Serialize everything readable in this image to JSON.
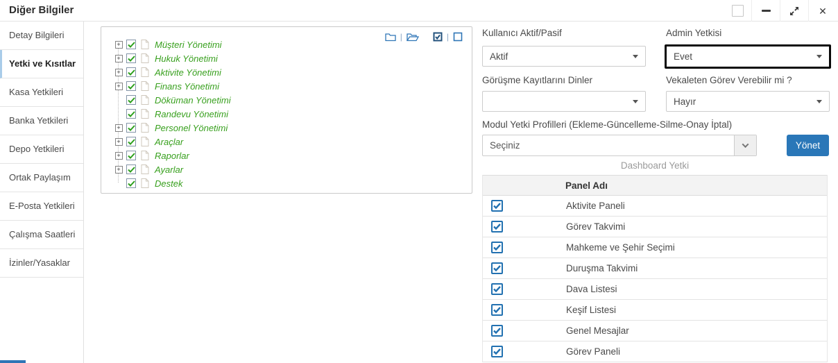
{
  "window": {
    "title": "Diğer Bilgiler",
    "controls": {
      "box": "box-icon",
      "minimize": "minimize-icon",
      "maximize": "maximize-icon",
      "close": "close-icon"
    }
  },
  "sidebar": {
    "items": [
      {
        "label": "Detay Bilgileri",
        "active": false
      },
      {
        "label": "Yetki ve Kısıtlar",
        "active": true
      },
      {
        "label": "Kasa Yetkileri",
        "active": false
      },
      {
        "label": "Banka Yetkileri",
        "active": false
      },
      {
        "label": "Depo Yetkileri",
        "active": false
      },
      {
        "label": "Ortak Paylaşım",
        "active": false
      },
      {
        "label": "E-Posta Yetkileri",
        "active": false
      },
      {
        "label": "Çalışma Saatleri",
        "active": false
      },
      {
        "label": "İzinler/Yasaklar",
        "active": false
      }
    ]
  },
  "tree": {
    "toolbar_icons": [
      "folder-closed-icon",
      "folder-open-icon",
      "check-all-icon",
      "uncheck-all-icon"
    ],
    "separator": "|",
    "items": [
      {
        "label": "Müşteri Yönetimi",
        "expandable": true,
        "checked": true
      },
      {
        "label": "Hukuk Yönetimi",
        "expandable": true,
        "checked": true
      },
      {
        "label": "Aktivite Yönetimi",
        "expandable": true,
        "checked": true
      },
      {
        "label": "Finans Yönetimi",
        "expandable": true,
        "checked": true
      },
      {
        "label": "Döküman Yönetimi",
        "expandable": false,
        "checked": true
      },
      {
        "label": "Randevu Yönetimi",
        "expandable": false,
        "checked": true
      },
      {
        "label": "Personel Yönetimi",
        "expandable": true,
        "checked": true
      },
      {
        "label": "Araçlar",
        "expandable": true,
        "checked": true
      },
      {
        "label": "Raporlar",
        "expandable": true,
        "checked": true
      },
      {
        "label": "Ayarlar",
        "expandable": true,
        "checked": true
      },
      {
        "label": "Destek",
        "expandable": false,
        "checked": true
      }
    ]
  },
  "form": {
    "fields": [
      {
        "label": "Kullanıcı Aktif/Pasif",
        "value": "Aktif",
        "focused": false
      },
      {
        "label": "Admin Yetkisi",
        "value": "Evet",
        "focused": true
      },
      {
        "label": "Görüşme Kayıtlarını Dinler",
        "value": "",
        "focused": false
      },
      {
        "label": "Vekaleten Görev Verebilir mi ?",
        "value": "Hayır",
        "focused": false
      }
    ],
    "profile_label": "Modul Yetki Profilleri (Ekleme-Güncelleme-Silme-Onay İptal)",
    "profile_placeholder": "Seçiniz",
    "manage_button": "Yönet"
  },
  "dashboard": {
    "title": "Dashboard Yetki",
    "table": {
      "header": "Panel Adı",
      "rows": [
        {
          "label": "Aktivite Paneli",
          "checked": true
        },
        {
          "label": "Görev Takvimi",
          "checked": true
        },
        {
          "label": "Mahkeme ve Şehir Seçimi",
          "checked": true
        },
        {
          "label": "Duruşma Takvimi",
          "checked": true
        },
        {
          "label": "Dava Listesi",
          "checked": true
        },
        {
          "label": "Keşif Listesi",
          "checked": true
        },
        {
          "label": "Genel Mesajlar",
          "checked": true
        },
        {
          "label": "Görev Paneli",
          "checked": true
        }
      ]
    }
  },
  "colors": {
    "accent_blue": "#2e75b6",
    "button_blue": "#2a77b8",
    "tree_green": "#38a01e",
    "table_check_blue": "#2271b1",
    "focus_border": "#000000"
  }
}
